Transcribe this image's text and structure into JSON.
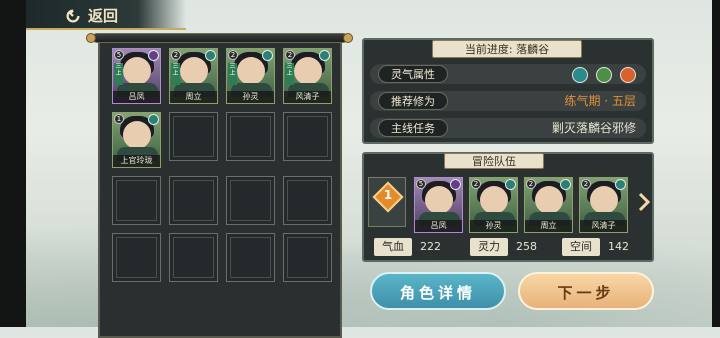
{
  "header": {
    "back_label": "返回"
  },
  "roster": {
    "characters": [
      {
        "name": "吕凤",
        "level": "5",
        "element": "purple",
        "tag": "三上"
      },
      {
        "name": "周立",
        "level": "2",
        "element": "teal",
        "tag": "三上"
      },
      {
        "name": "孙灵",
        "level": "2",
        "element": "teal",
        "tag": "三上"
      },
      {
        "name": "风清子",
        "level": "2",
        "element": "teal",
        "tag": "三上"
      },
      {
        "name": "上官玲珑",
        "level": "1",
        "element": "teal",
        "tag": ""
      }
    ]
  },
  "info": {
    "progress_title": "当前进度: 落麟谷",
    "rows": [
      {
        "label": "灵气属性",
        "value": ""
      },
      {
        "label": "推荐修为",
        "value": "练气期 · 五层"
      },
      {
        "label": "主线任务",
        "value": "剿灭落麟谷邪修"
      }
    ],
    "element_icons": [
      "water-icon",
      "wood-icon",
      "fire-icon"
    ],
    "colors": {
      "water": "#2b8a8a",
      "wood": "#4d8f45",
      "fire": "#d9612b"
    }
  },
  "team": {
    "title": "冒险队伍",
    "badge_number": "1",
    "members": [
      {
        "name": "吕凤",
        "level": "5",
        "element": "purple"
      },
      {
        "name": "孙灵",
        "level": "2",
        "element": "teal"
      },
      {
        "name": "周立",
        "level": "2",
        "element": "teal"
      },
      {
        "name": "风清子",
        "level": "2",
        "element": "teal"
      }
    ],
    "stats": [
      {
        "label": "气血",
        "value": "222"
      },
      {
        "label": "灵力",
        "value": "258"
      },
      {
        "label": "空间",
        "value": "142"
      }
    ]
  },
  "buttons": {
    "detail": "角色详情",
    "next": "下一步"
  }
}
